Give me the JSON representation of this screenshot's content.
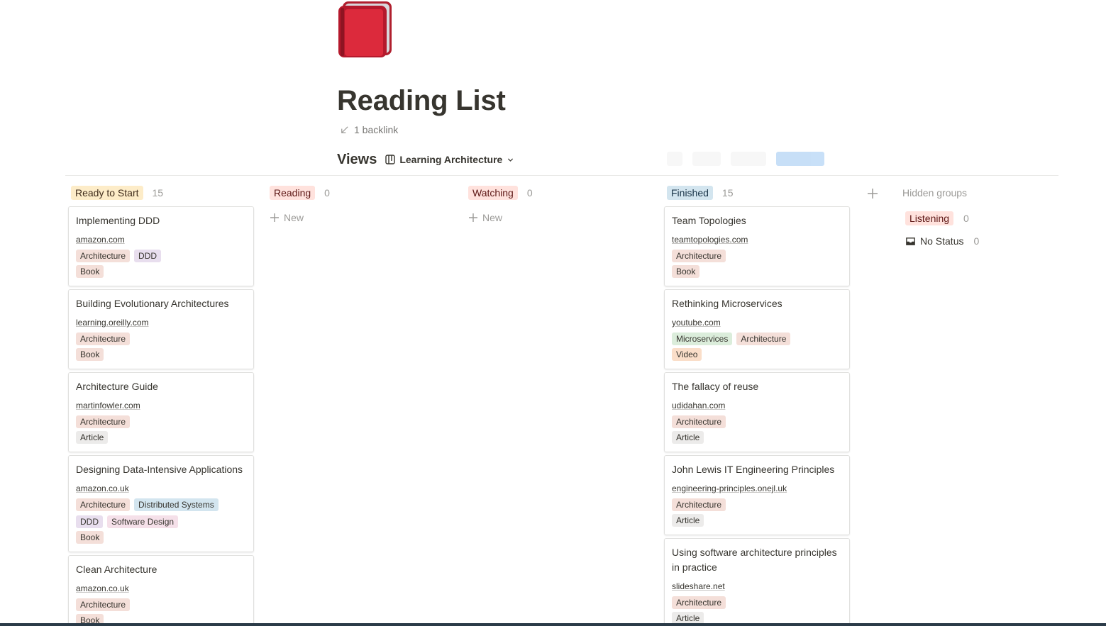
{
  "page": {
    "title": "Reading List",
    "backlink": "1 backlink",
    "icon": "red-book-icon"
  },
  "views": {
    "label": "Views",
    "current_view": "Learning Architecture"
  },
  "tag_colors": {
    "Architecture": "#f4dfd9",
    "DDD": "#e8deee",
    "Book": "#f4dfd9",
    "Article": "#ecebea",
    "Video": "#fadec9",
    "Microservices": "#dbeddb",
    "Distributed Systems": "#d3e5ef",
    "Software Design": "#f5e0e9"
  },
  "columns": [
    {
      "name": "Ready to Start",
      "count": "15",
      "pill_color": "#fdecc8",
      "cards": [
        {
          "title": "Implementing DDD",
          "url": "amazon.com",
          "tags": [
            "Architecture",
            "DDD"
          ],
          "type": "Book"
        },
        {
          "title": "Building Evolutionary Architectures",
          "url": "learning.oreilly.com",
          "tags": [
            "Architecture"
          ],
          "type": "Book"
        },
        {
          "title": "Architecture Guide",
          "url": "martinfowler.com",
          "tags": [
            "Architecture"
          ],
          "type": "Article"
        },
        {
          "title": "Designing Data-Intensive Applications",
          "url": "amazon.co.uk",
          "tags": [
            "Architecture",
            "Distributed Systems",
            "DDD",
            "Software Design"
          ],
          "type": "Book"
        },
        {
          "title": "Clean Architecture",
          "url": "amazon.co.uk",
          "tags": [
            "Architecture"
          ],
          "type": "Book"
        }
      ]
    },
    {
      "name": "Reading",
      "count": "0",
      "pill_color": "#ffe2dd",
      "new_label": "New",
      "cards": []
    },
    {
      "name": "Watching",
      "count": "0",
      "pill_color": "#ffe2dd",
      "new_label": "New",
      "cards": []
    },
    {
      "name": "Finished",
      "count": "15",
      "pill_color": "#d3e5ef",
      "cards": [
        {
          "title": "Team Topologies",
          "url": "teamtopologies.com",
          "tags": [
            "Architecture"
          ],
          "type": "Book"
        },
        {
          "title": "Rethinking Microservices",
          "url": "youtube.com",
          "tags": [
            "Microservices",
            "Architecture"
          ],
          "type": "Video"
        },
        {
          "title": "The fallacy of reuse",
          "url": "udidahan.com",
          "tags": [
            "Architecture"
          ],
          "type": "Article"
        },
        {
          "title": "John Lewis IT Engineering Principles",
          "url": "engineering-principles.onejl.uk",
          "tags": [
            "Architecture"
          ],
          "type": "Article"
        },
        {
          "title": "Using software architecture principles in practice",
          "url": "slideshare.net",
          "tags": [
            "Architecture"
          ],
          "type": "Article"
        }
      ]
    }
  ],
  "hidden_groups": {
    "title": "Hidden groups",
    "groups": [
      {
        "name": "Listening",
        "count": "0",
        "pill_color": "#ffe2dd"
      },
      {
        "name": "No Status",
        "count": "0",
        "icon": "inbox-icon"
      }
    ]
  }
}
